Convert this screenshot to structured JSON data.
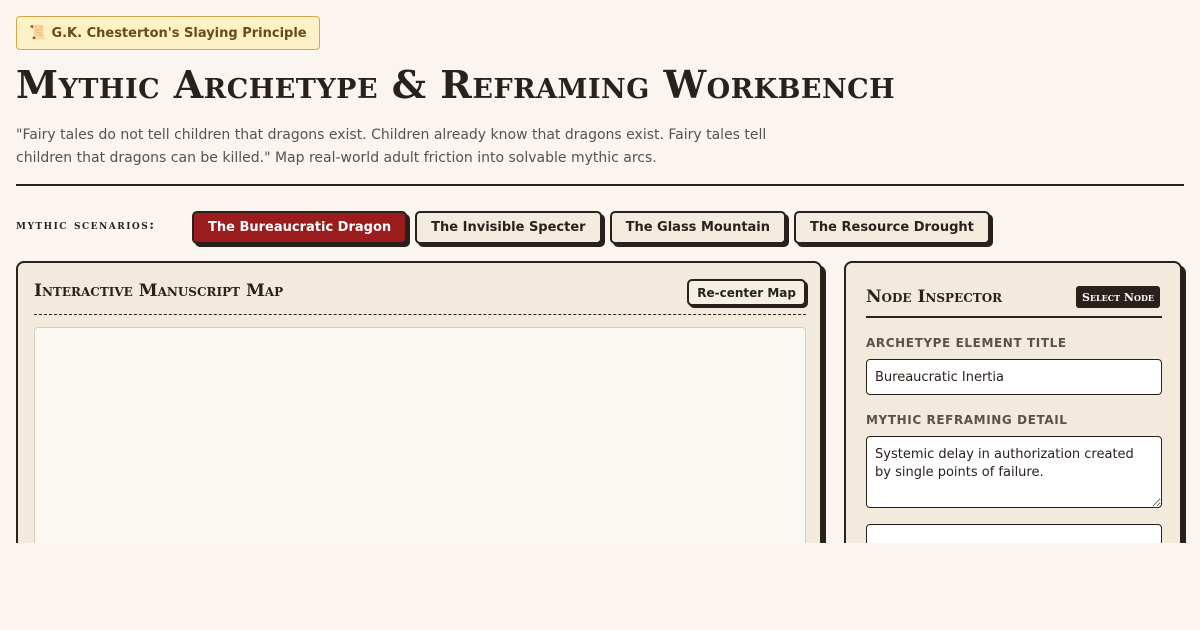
{
  "badge": {
    "icon": "scroll-icon",
    "glyph": "📜",
    "label": "G.K. Chesterton's Slaying Principle"
  },
  "title": "Mythic Archetype & Reframing Workbench",
  "quote": "\"Fairy tales do not tell children that dragons exist. Children already know that dragons exist. Fairy tales tell children that dragons can be killed.\" Map real-world adult friction into solvable mythic arcs.",
  "scenarios": {
    "label": "mythic scenarios:",
    "tabs": [
      {
        "label": "The Bureaucratic Dragon",
        "active": true
      },
      {
        "label": "The Invisible Specter",
        "active": false
      },
      {
        "label": "The Glass Mountain",
        "active": false
      },
      {
        "label": "The Resource Drought",
        "active": false
      }
    ]
  },
  "map": {
    "title": "Interactive Manuscript Map",
    "recenter_label": "Re-center Map"
  },
  "inspector": {
    "title": "Node Inspector",
    "select_badge": "Select Node",
    "element_title_label": "Archetype Element Title",
    "element_title_value": "Bureaucratic Inertia",
    "reframing_label": "Mythic Reframing Detail",
    "reframing_value": "Systemic delay in authorization created by single points of failure."
  },
  "colors": {
    "accent": "#9b1c1c",
    "ink": "#2b211c",
    "parchment": "#f2eadd",
    "page": "#faf6ef"
  }
}
